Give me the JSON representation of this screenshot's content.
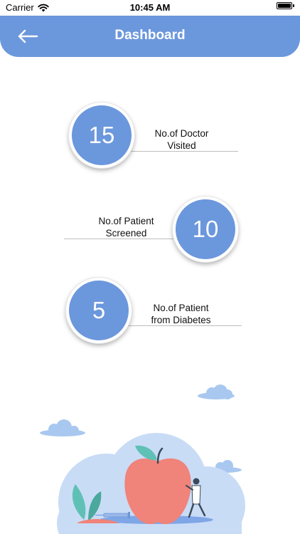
{
  "status_bar": {
    "carrier": "Carrier",
    "time": "10:45 AM"
  },
  "header": {
    "title": "Dashboard",
    "back_icon": "arrow-left-icon"
  },
  "stats": [
    {
      "value": "15",
      "label_line1": "No.of Doctor",
      "label_line2": "Visited"
    },
    {
      "value": "10",
      "label_line1": "No.of Patient",
      "label_line2": "Screened"
    },
    {
      "value": "5",
      "label_line1": "No.of Patient",
      "label_line2": "from Diabetes"
    }
  ],
  "colors": {
    "accent": "#6b97dc",
    "cloud": "#a9c8f0",
    "apple": "#f0837a",
    "leaf": "#5fc1b5"
  }
}
